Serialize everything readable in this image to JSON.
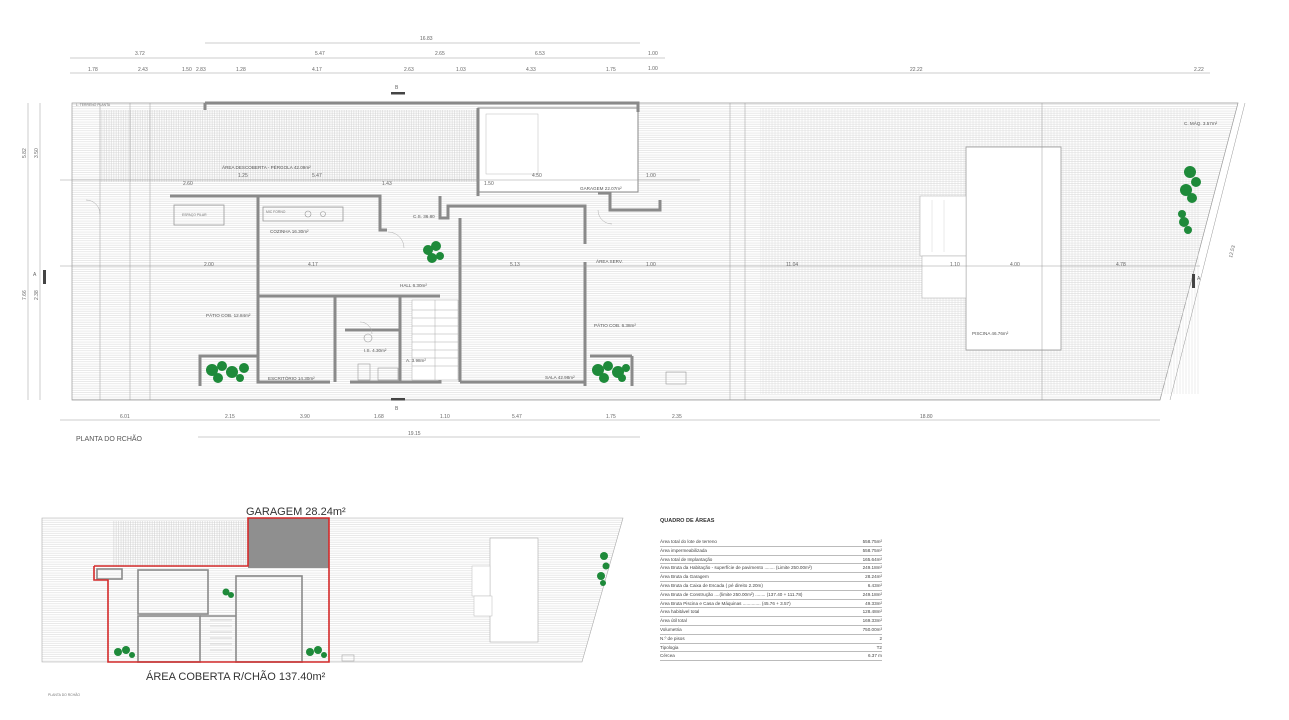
{
  "plan": {
    "title": "PLANTA DO RCHÃO",
    "top_dims_row1": [
      "16.83",
      "1.00"
    ],
    "top_dims_row2": [
      "3.72",
      "5.47",
      "2.65",
      "6.53",
      "1.00"
    ],
    "top_dims_row3": [
      "1.78",
      "2.43",
      "1.50",
      "2.83",
      "1.28",
      "4.17",
      "2.63",
      "1.03",
      "4.33",
      "1.75",
      "22.22",
      "2.22"
    ],
    "bottom_dims_row1": [
      "6.01",
      "2.15",
      "3.90",
      "1.68",
      "1.10",
      "5.47",
      "1.75",
      "2.35",
      "18.80"
    ],
    "bottom_dims_row2": [
      "19.15"
    ],
    "left_dims": [
      "5.82",
      "3.50",
      "7.66",
      "2.38"
    ],
    "right_dims": [
      "12.53"
    ],
    "section_mark_top": "B",
    "section_mark_bottom": "B",
    "section_mark_left": "A",
    "section_mark_right": "A",
    "rooms": [
      {
        "name": "pergola",
        "label": "ÁREA DESCOBERTA - PÉRGOLA 42.09m²"
      },
      {
        "name": "garagem",
        "label": "GARAGEM 22.07m²"
      },
      {
        "name": "cozinha",
        "label": "COZINHA 16.30m²"
      },
      {
        "name": "mic-forno",
        "label": "MIC FORNO"
      },
      {
        "name": "cs",
        "label": "C.S. 36.80"
      },
      {
        "name": "hall",
        "label": "HALL 6.30m²"
      },
      {
        "name": "area-servico",
        "label": "ÁREA SERV."
      },
      {
        "name": "patio-cob-left",
        "label": "PÁTIO COB. 12.84m²"
      },
      {
        "name": "patio-cob-right",
        "label": "PÁTIO COB. 6.38m²"
      },
      {
        "name": "escritorio",
        "label": "ESCRITÓRIO 14.30m²"
      },
      {
        "name": "is",
        "label": "I.S. 4.30m²"
      },
      {
        "name": "arrumos",
        "label": "A. 3.98m²"
      },
      {
        "name": "sala",
        "label": "SALA 42.98m²"
      },
      {
        "name": "piscina",
        "label": "PISCINA 46.76m²"
      },
      {
        "name": "maquinas",
        "label": "C. MÁQ. 3.57m²"
      },
      {
        "name": "espaco-pilar",
        "label": "ESPAÇO PILAR"
      },
      {
        "name": "limite",
        "label": "L. TERRENO PLANTA"
      }
    ],
    "inner_dims": [
      "2.60",
      "1.25",
      "5.47",
      "1.43",
      "1.50",
      "4.50",
      "1.00",
      "4.17",
      "5.13",
      "11.04",
      "1.10",
      "4.00",
      "4.78",
      "2.00",
      "1.00"
    ]
  },
  "mini": {
    "garagem_label": "GARAGEM 28.24m²",
    "area_label": "ÁREA COBERTA R/CHÃO 137.40m²",
    "caption": "PLANTA DO RCHÃO"
  },
  "areas": {
    "title": "QUADRO DE ÁREAS",
    "rows": [
      {
        "label": "Área total do lote de terreno",
        "value": "558.75m²"
      },
      {
        "label": "Área impermeabilizada",
        "value": "558.75m²"
      },
      {
        "label": "Área total de Implantação",
        "value": "165.64m²"
      },
      {
        "label": "Área Bruta da Habitação - superfície de pavimento ........ (Limite 250.00m²)",
        "value": "249.18m²"
      },
      {
        "label": "Área Bruta da Garagem",
        "value": "28.24m²"
      },
      {
        "label": "Área Bruta da Caixa de Escada ( pé direito 2.20m)",
        "value": "6.43m²"
      },
      {
        "label": "Área Bruta de Construção ....(limite 250.00m²) ........ (137.40 + 111.78)",
        "value": "249.18m²"
      },
      {
        "label": "Área Bruta Piscina e Casa de Máquinas .............. (45.76 + 3.57)",
        "value": "49.33m²"
      },
      {
        "label": "Área habitável total",
        "value": "128.48m²"
      },
      {
        "label": "Área útil total",
        "value": "169.33m²"
      },
      {
        "label": "Volumetria",
        "value": "750.00m³"
      },
      {
        "label": "N.º de pisos",
        "value": "2"
      },
      {
        "label": "Tipologia",
        "value": "T2"
      },
      {
        "label": "Cércea",
        "value": "6.37 m"
      }
    ]
  },
  "colors": {
    "wall": "#8a8a8a",
    "hatch": "#cfcfcf",
    "red_outline": "#d42a2a",
    "garage_fill": "#8f8f8f",
    "plant": "#1e8a3a"
  }
}
